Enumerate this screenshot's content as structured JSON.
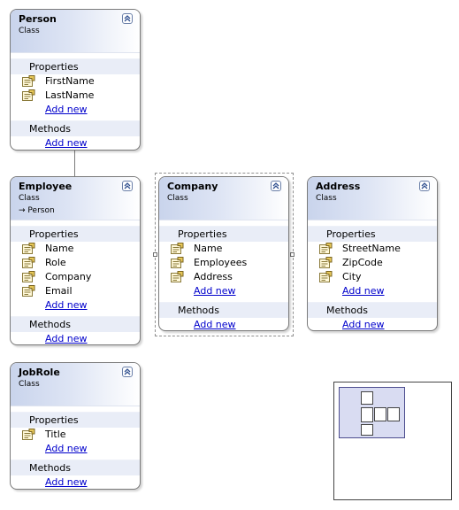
{
  "diagram": {
    "classes": [
      {
        "id": "person",
        "name": "Person",
        "kind": "Class",
        "base": "",
        "properties_label": "Properties",
        "properties": [
          "FirstName",
          "LastName"
        ],
        "add_new_property": "Add new",
        "methods_label": "Methods",
        "add_new_method": "Add new"
      },
      {
        "id": "employee",
        "name": "Employee",
        "kind": "Class",
        "base": "Person",
        "properties_label": "Properties",
        "properties": [
          "Name",
          "Role",
          "Company",
          "Email"
        ],
        "add_new_property": "Add new",
        "methods_label": "Methods",
        "add_new_method": "Add new"
      },
      {
        "id": "company",
        "name": "Company",
        "kind": "Class",
        "base": "",
        "properties_label": "Properties",
        "properties": [
          "Name",
          "Employees",
          "Address"
        ],
        "add_new_property": "Add new",
        "methods_label": "Methods",
        "add_new_method": "Add new",
        "selected": true
      },
      {
        "id": "address",
        "name": "Address",
        "kind": "Class",
        "base": "",
        "properties_label": "Properties",
        "properties": [
          "StreetName",
          "ZipCode",
          "City"
        ],
        "add_new_property": "Add new",
        "methods_label": "Methods",
        "add_new_method": "Add new"
      },
      {
        "id": "jobrole",
        "name": "JobRole",
        "kind": "Class",
        "base": "",
        "properties_label": "Properties",
        "properties": [
          "Title"
        ],
        "add_new_property": "Add new",
        "methods_label": "Methods",
        "add_new_method": "Add new"
      }
    ],
    "inheritance_arrow": "→",
    "icons": {
      "property": "property-icon",
      "collapse": "collapse-chevrons-icon"
    },
    "colors": {
      "header_gradient_start": "#c9d4ec",
      "section_band": "#e9edf7",
      "link": "#0000cc",
      "border": "#7a7a7a"
    }
  }
}
